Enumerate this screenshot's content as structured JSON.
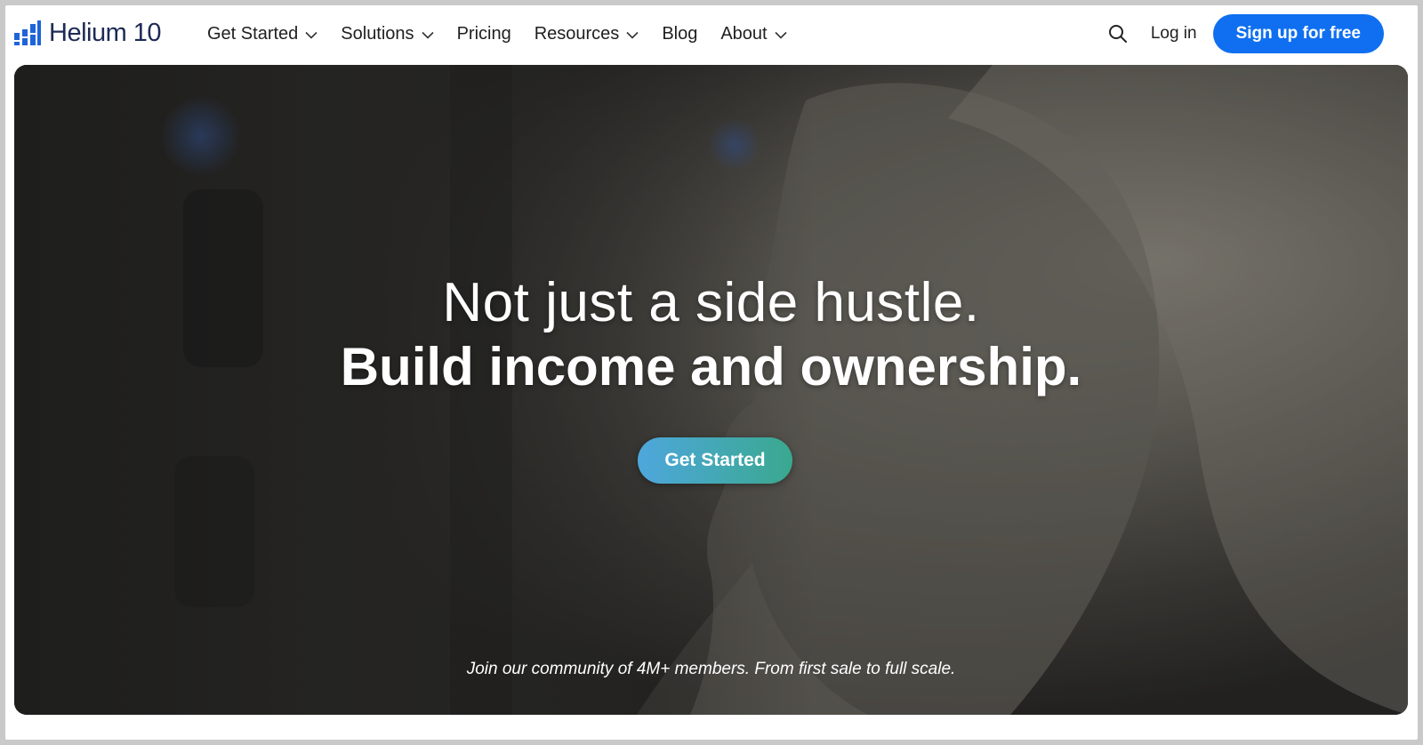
{
  "brand": {
    "name": "Helium 10",
    "color": "#1d2a55",
    "accent": "#0f6ff0"
  },
  "nav": {
    "items": [
      {
        "label": "Get Started",
        "has_dropdown": true
      },
      {
        "label": "Solutions",
        "has_dropdown": true
      },
      {
        "label": "Pricing",
        "has_dropdown": false
      },
      {
        "label": "Resources",
        "has_dropdown": true
      },
      {
        "label": "Blog",
        "has_dropdown": false
      },
      {
        "label": "About",
        "has_dropdown": true
      }
    ],
    "search_icon": "search-icon",
    "login_label": "Log in",
    "signup_label": "Sign up for free"
  },
  "hero": {
    "headline_line1": "Not just a side hustle.",
    "headline_line2": "Build income and ownership.",
    "cta_label": "Get Started",
    "tagline": "Join our community of 4M+ members. From first sale to full scale.",
    "cta_gradient": [
      "#4ea7dc",
      "#3aa88f"
    ]
  }
}
